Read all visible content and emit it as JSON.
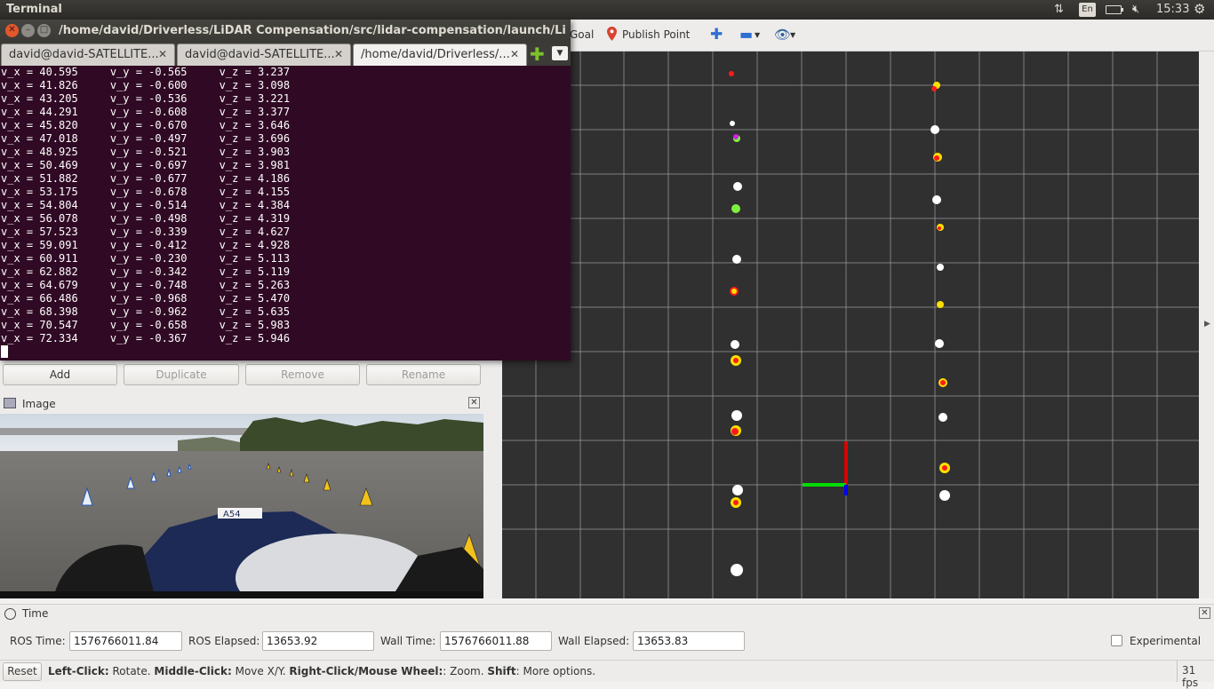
{
  "system_bar": {
    "app_title": "Terminal",
    "keyboard_layout": "En",
    "time": "15:33"
  },
  "rviz_toolbar": {
    "goal_label": "Goal",
    "publish_point_label": "Publish Point"
  },
  "terminal": {
    "window_title": "/home/david/Driverless/LiDAR Compensation/src/lidar-compensation/launch/LidarCompensation",
    "tabs": [
      {
        "label": "david@david-SATELLITE..."
      },
      {
        "label": "david@david-SATELLITE..."
      },
      {
        "label": "/home/david/Driverless/..."
      }
    ],
    "lines": [
      "v_x = 40.595     v_y = -0.565     v_z = 3.237",
      "v_x = 41.826     v_y = -0.600     v_z = 3.098",
      "v_x = 43.205     v_y = -0.536     v_z = 3.221",
      "v_x = 44.291     v_y = -0.608     v_z = 3.377",
      "v_x = 45.820     v_y = -0.670     v_z = 3.646",
      "v_x = 47.018     v_y = -0.497     v_z = 3.696",
      "v_x = 48.925     v_y = -0.521     v_z = 3.903",
      "v_x = 50.469     v_y = -0.697     v_z = 3.981",
      "v_x = 51.882     v_y = -0.677     v_z = 4.186",
      "v_x = 53.175     v_y = -0.678     v_z = 4.155",
      "v_x = 54.804     v_y = -0.514     v_z = 4.384",
      "v_x = 56.078     v_y = -0.498     v_z = 4.319",
      "v_x = 57.523     v_y = -0.339     v_z = 4.627",
      "v_x = 59.091     v_y = -0.412     v_z = 4.928",
      "v_x = 60.911     v_y = -0.230     v_z = 5.113",
      "v_x = 62.882     v_y = -0.342     v_z = 5.119",
      "v_x = 64.679     v_y = -0.748     v_z = 5.263",
      "v_x = 66.486     v_y = -0.968     v_z = 5.470",
      "v_x = 68.398     v_y = -0.962     v_z = 5.635",
      "v_x = 70.547     v_y = -0.658     v_z = 5.983",
      "v_x = 72.334     v_y = -0.367     v_z = 5.946"
    ]
  },
  "displays_panel": {
    "add_label": "Add",
    "duplicate_label": "Duplicate",
    "remove_label": "Remove",
    "rename_label": "Rename"
  },
  "image_panel": {
    "title": "Image",
    "car_number": "A54"
  },
  "time_panel": {
    "title": "Time",
    "ros_time_label": "ROS Time:",
    "ros_time_value": "1576766011.84",
    "ros_elapsed_label": "ROS Elapsed:",
    "ros_elapsed_value": "13653.92",
    "wall_time_label": "Wall Time:",
    "wall_time_value": "1576766011.88",
    "wall_elapsed_label": "Wall Elapsed:",
    "wall_elapsed_value": "13653.83",
    "experimental_label": "Experimental"
  },
  "status_bar": {
    "reset_label": "Reset",
    "hint_left_click": "Left-Click:",
    "hint_rotate": " Rotate. ",
    "hint_middle_click": "Middle-Click:",
    "hint_move": " Move X/Y. ",
    "hint_right_click": "Right-Click/Mouse Wheel:",
    "hint_zoom": ": Zoom. ",
    "hint_shift": "Shift",
    "hint_more": ": More options.",
    "fps": "31 fps"
  },
  "colors": {
    "terminal_bg": "#300a24",
    "view_bg": "#303030",
    "grid": "#a0a0a0",
    "cone_white": "#ffffff",
    "cone_yellow": "#ffe000",
    "cone_red": "#ff1a1a",
    "cone_green": "#7ef040",
    "axis_x": "#dd0000",
    "axis_y": "#00dd00",
    "axis_z": "#0000ff"
  },
  "icons": {
    "sync": "sync-arrows-icon",
    "battery": "battery-icon",
    "volume": "volume-muted-icon",
    "settings": "gear-icon"
  }
}
